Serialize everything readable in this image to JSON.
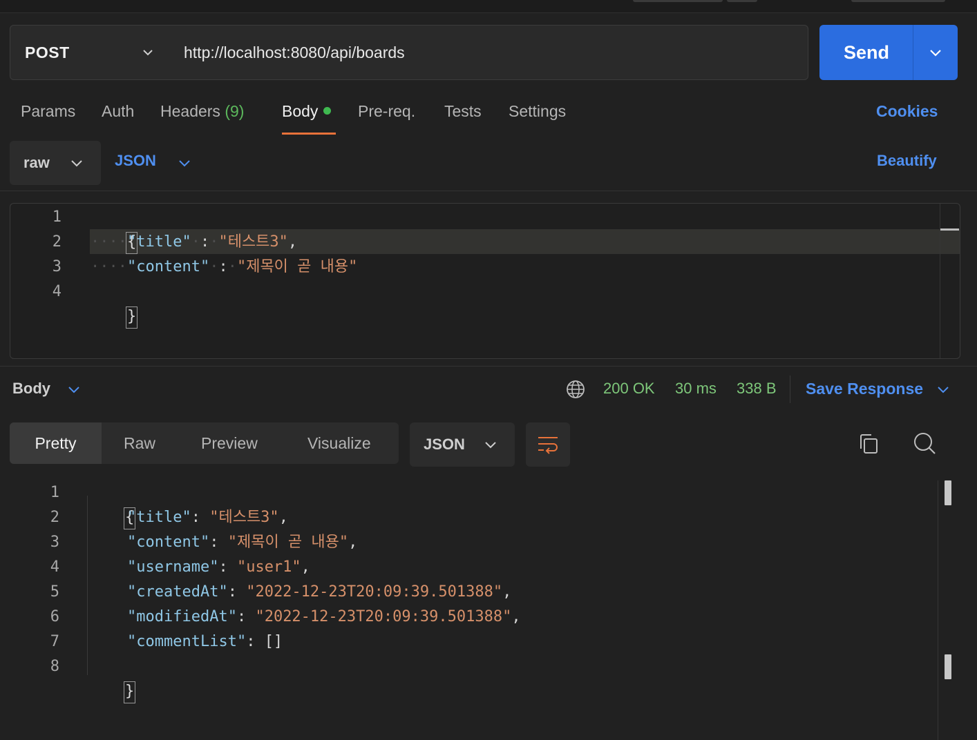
{
  "request": {
    "method": "POST",
    "url": "http://localhost:8080/api/boards",
    "send_label": "Send"
  },
  "request_tabs": {
    "params": "Params",
    "auth": "Auth",
    "headers": "Headers",
    "headers_count": "(9)",
    "body": "Body",
    "prereq": "Pre-req.",
    "tests": "Tests",
    "settings": "Settings",
    "cookies": "Cookies",
    "active": "Body"
  },
  "body_options": {
    "mode": "raw",
    "language": "JSON",
    "beautify": "Beautify"
  },
  "editor": {
    "line_numbers": [
      "1",
      "2",
      "3",
      "4"
    ],
    "open_brace": "{",
    "close_brace": "}",
    "title_key": "\"title\"",
    "title_value": "\"테스트3\"",
    "content_key": "\"content\"",
    "content_value": "\"제목이 곧 내용\""
  },
  "response": {
    "section_label": "Body",
    "status": "200 OK",
    "time": "30 ms",
    "size": "338 B",
    "save_response": "Save Response",
    "view_tabs": [
      "Pretty",
      "Raw",
      "Preview",
      "Visualize"
    ],
    "active_view": "Pretty",
    "format": "JSON",
    "line_numbers": [
      "1",
      "2",
      "3",
      "4",
      "5",
      "6",
      "7",
      "8"
    ],
    "open_brace": "{",
    "close_brace": "}",
    "fields": [
      {
        "key": "\"title\"",
        "value": "\"테스트3\""
      },
      {
        "key": "\"content\"",
        "value": "\"제목이 곧 내용\""
      },
      {
        "key": "\"username\"",
        "value": "\"user1\""
      },
      {
        "key": "\"createdAt\"",
        "value": "\"2022-12-23T20:09:39.501388\""
      },
      {
        "key": "\"modifiedAt\"",
        "value": "\"2022-12-23T20:09:39.501388\""
      },
      {
        "key": "\"commentList\"",
        "value": "[]"
      }
    ]
  },
  "icons": {
    "method_dropdown": "chevron-down-icon",
    "send_dropdown": "chevron-down-icon",
    "network": "globe-icon",
    "wrap": "wrap-lines-icon",
    "copy": "copy-icon",
    "search": "search-icon"
  },
  "colors": {
    "send_button": "#2b6de0",
    "link_blue": "#4f8ff0",
    "status_green": "#7ec77a",
    "active_tab_underline": "#e8723a",
    "body_dot": "#3fb950",
    "json_key": "#8fc7e6",
    "json_string": "#d6906a"
  }
}
